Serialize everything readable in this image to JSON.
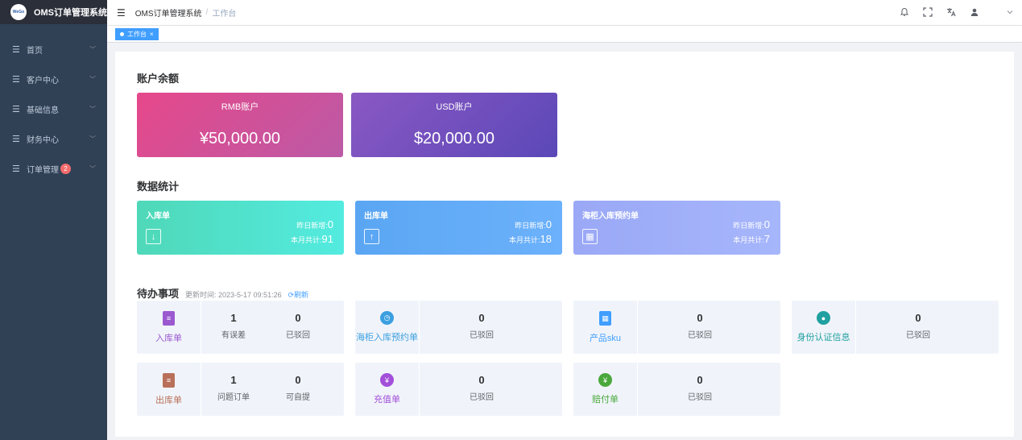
{
  "app": {
    "logo_text": "OMS订单管理系统",
    "logo_mark": "WeGo"
  },
  "sidebar": {
    "items": [
      {
        "label": "首页"
      },
      {
        "label": "客户中心"
      },
      {
        "label": "基础信息"
      },
      {
        "label": "财务中心"
      },
      {
        "label": "订单管理",
        "badge": "2"
      }
    ]
  },
  "navbar": {
    "breadcrumb_root": "OMS订单管理系统",
    "breadcrumb_sep": "/",
    "breadcrumb_current": "工作台"
  },
  "tags": {
    "active": "工作台",
    "close": "×"
  },
  "balance": {
    "title": "账户余额",
    "rmb": {
      "label": "RMB账户",
      "value": "¥50,000.00"
    },
    "usd": {
      "label": "USD账户",
      "value": "$20,000.00"
    }
  },
  "stats": {
    "title": "数据统计",
    "yesterday_label": "昨日新增:",
    "month_label": "本月共计:",
    "items": [
      {
        "title": "入库单",
        "yesterday": "0",
        "month": "91"
      },
      {
        "title": "出库单",
        "yesterday": "0",
        "month": "18"
      },
      {
        "title": "海柜入库预约单",
        "yesterday": "0",
        "month": "7"
      }
    ]
  },
  "todo": {
    "title": "待办事项",
    "updated": "更新时间: 2023-5-17 09:51:26",
    "refresh": "刷新",
    "items": [
      {
        "name": "入库单",
        "color": "#9b59d0",
        "cells": [
          {
            "n": "1",
            "c": "有误差"
          },
          {
            "n": "0",
            "c": "已驳回"
          }
        ]
      },
      {
        "name": "海柜入库预约单",
        "color": "#3b9fe0",
        "cells": [
          {
            "n": "0",
            "c": "已驳回"
          }
        ]
      },
      {
        "name": "产品sku",
        "color": "#409eff",
        "cells": [
          {
            "n": "0",
            "c": "已驳回"
          }
        ]
      },
      {
        "name": "身份认证信息",
        "color": "#20a0a0",
        "cells": [
          {
            "n": "0",
            "c": "已驳回"
          }
        ]
      },
      {
        "name": "出库单",
        "color": "#b9705a",
        "cells": [
          {
            "n": "1",
            "c": "问题订单"
          },
          {
            "n": "0",
            "c": "可自提"
          }
        ]
      },
      {
        "name": "充值单",
        "color": "#a24fd9",
        "cells": [
          {
            "n": "0",
            "c": "已驳回"
          }
        ]
      },
      {
        "name": "赔付单",
        "color": "#4aa83c",
        "cells": [
          {
            "n": "0",
            "c": "已驳回"
          }
        ]
      }
    ]
  },
  "colors": {
    "sidebar_bg": "#304156",
    "accent": "#409eff",
    "rmb_gradient": [
      "#e6488a",
      "#bc5aa6"
    ],
    "usd_gradient": [
      "#8a58c3",
      "#5b48b8"
    ],
    "stat1": [
      "#4fd8b8",
      "#53ebe0"
    ],
    "stat2": [
      "#5aa6f3",
      "#6cb1fb"
    ],
    "stat3": [
      "#9aa8f6",
      "#a6b6fb"
    ]
  }
}
